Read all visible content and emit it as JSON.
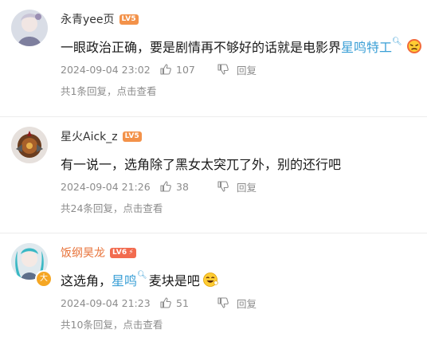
{
  "comments": [
    {
      "username": "永青yee页",
      "level": "LV5",
      "text_plain": "一眼政治正确，要是剧情再不够好的话就是电影界",
      "text_link": "星鸣特工",
      "time": "2024-09-04 23:02",
      "likes": "107",
      "reply_label": "回复",
      "reply_summary": "共1条回复，点击查看"
    },
    {
      "username": "星火Aick_z",
      "level": "LV5",
      "text_plain": "有一说一，选角除了黑女太突兀了外，别的还行吧",
      "text_link": "",
      "time": "2024-09-04 21:26",
      "likes": "38",
      "reply_label": "回复",
      "reply_summary": "共24条回复，点击查看"
    },
    {
      "username": "饭纲昊龙",
      "level": "LV6",
      "avatar_badge": "大",
      "text_before": "这选角，",
      "text_link": "星鸣",
      "text_after": "麦块是吧",
      "time": "2024-09-04 21:23",
      "likes": "51",
      "reply_label": "回复",
      "reply_summary": "共10条回复，点击查看"
    }
  ],
  "colors": {
    "link": "#3a9fd6",
    "meta": "#8c8c8c",
    "level_badge": "#f3924a",
    "vip_name": "#e8733a"
  },
  "icons": [
    "search-mark-icon",
    "thumbs-up-icon",
    "thumbs-down-icon",
    "angry-emoji-icon",
    "laughing-emoji-icon"
  ]
}
